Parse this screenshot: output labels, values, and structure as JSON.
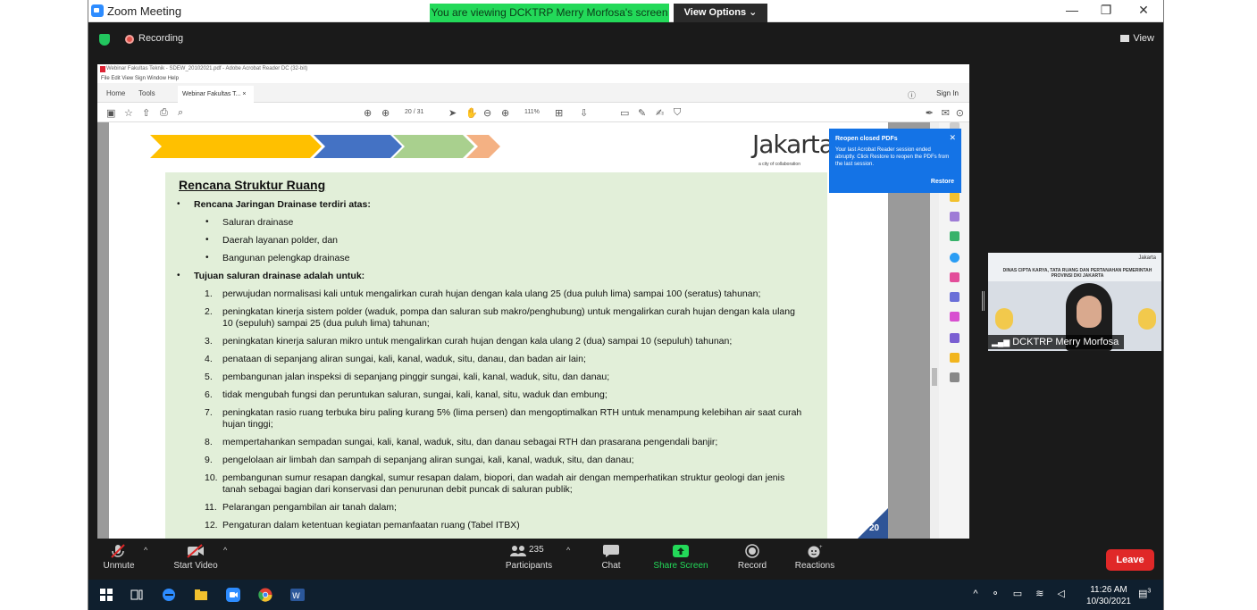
{
  "window": {
    "title": "Zoom Meeting",
    "minimize": "—",
    "restore": "❐",
    "close": "✕"
  },
  "banner": {
    "viewing": "You are viewing DCKTRP Merry Morfosa's screen",
    "view_options": "View Options ⌄"
  },
  "top": {
    "recording": "Recording",
    "view": "View"
  },
  "acrobat": {
    "title": "Webinar Fakultas Teknik - SDEW_20102021.pdf - Adobe Acrobat Reader DC (32-bit)",
    "menu": "File  Edit  View  Sign  Window  Help",
    "home_tab": "Home",
    "tools_tab": "Tools",
    "doc_tab": "Webinar Fakultas T...  ×",
    "sign_in": "Sign In",
    "page_indicator": "20 / 31",
    "zoom": "111%",
    "popup": {
      "title": "Reopen closed PDFs",
      "body": "Your last Acrobat Reader session ended abruptly. Click Restore to reopen the PDFs from the last session.",
      "restore": "Restore",
      "close": "✕"
    }
  },
  "slide": {
    "logo": "Jakarta",
    "logo_sub": "a city of collaboration",
    "title": "Rencana Struktur Ruang",
    "section1": "Rencana Jaringan Drainase terdiri atas:",
    "sub_items": [
      "Saluran drainase",
      "Daerah layanan polder, dan",
      "Bangunan pelengkap drainase"
    ],
    "section2": "Tujuan saluran drainase adalah untuk:",
    "items": [
      {
        "n": "1.",
        "lines": [
          "perwujudan normalisasi kali untuk mengalirkan curah hujan dengan kala ulang 25 (dua puluh lima) sampai 100 (seratus) tahunan;"
        ]
      },
      {
        "n": "2.",
        "lines": [
          "peningkatan kinerja sistem polder (waduk, pompa dan saluran sub makro/penghubung) untuk mengalirkan curah hujan dengan kala ulang",
          "10 (sepuluh) sampai 25 (dua puluh lima) tahunan;"
        ]
      },
      {
        "n": "3.",
        "lines": [
          "peningkatan kinerja saluran mikro untuk mengalirkan curah hujan dengan kala ulang 2 (dua) sampai 10 (sepuluh) tahunan;"
        ]
      },
      {
        "n": "4.",
        "lines": [
          "penataan di sepanjang aliran sungai, kali, kanal, waduk, situ, danau, dan badan air lain;"
        ]
      },
      {
        "n": "5.",
        "lines": [
          "pembangunan jalan inspeksi di sepanjang pinggir sungai, kali, kanal, waduk, situ, dan danau;"
        ]
      },
      {
        "n": "6.",
        "lines": [
          "tidak mengubah fungsi dan peruntukan saluran, sungai, kali, kanal, situ, waduk dan embung;"
        ]
      },
      {
        "n": "7.",
        "lines": [
          "peningkatan rasio ruang terbuka biru paling kurang 5% (lima persen) dan mengoptimalkan RTH untuk menampung kelebihan air saat curah",
          "hujan tinggi;"
        ]
      },
      {
        "n": "8.",
        "lines": [
          "mempertahankan sempadan sungai, kali, kanal, waduk, situ, dan danau sebagai RTH dan prasarana pengendali banjir;"
        ]
      },
      {
        "n": "9.",
        "lines": [
          "pengelolaan air limbah dan sampah di sepanjang aliran sungai, kali, kanal, waduk, situ, dan danau;"
        ]
      },
      {
        "n": "10.",
        "lines": [
          "pembangunan sumur resapan dangkal, sumur resapan dalam, biopori, dan wadah air dengan memperhatikan struktur geologi dan jenis",
          "tanah sebagai bagian dari konservasi dan penurunan debit puncak di saluran publik;"
        ]
      },
      {
        "n": "11.",
        "lines": [
          "Pelarangan pengambilan air tanah dalam;"
        ]
      },
      {
        "n": "12.",
        "lines": [
          "Pengaturan dalam ketentuan kegiatan pemanfaatan ruang (Tabel ITBX)"
        ]
      }
    ],
    "page_number": "20"
  },
  "video": {
    "org_header": "DINAS CIPTA KARYA, TATA RUANG DAN PERTANAHAN PEMERINTAH PROVINSI DKI JAKARTA",
    "jakarta_small": "Jakarta",
    "participant_name": "DCKTRP Merry Morfosa"
  },
  "controls": {
    "unmute": "Unmute",
    "start_video": "Start Video",
    "participants": "Participants",
    "participant_count": "235",
    "chat": "Chat",
    "share_screen": "Share Screen",
    "record": "Record",
    "reactions": "Reactions",
    "leave": "Leave"
  },
  "taskbar": {
    "time": "11:26 AM",
    "date": "10/30/2021",
    "notifications": "3"
  },
  "colors": {
    "zoom_green": "#23d959",
    "share_green": "#23d959",
    "leave_red": "#e02828",
    "acrobat_blue": "#1473e6",
    "slide_blue": "#2f5597"
  }
}
